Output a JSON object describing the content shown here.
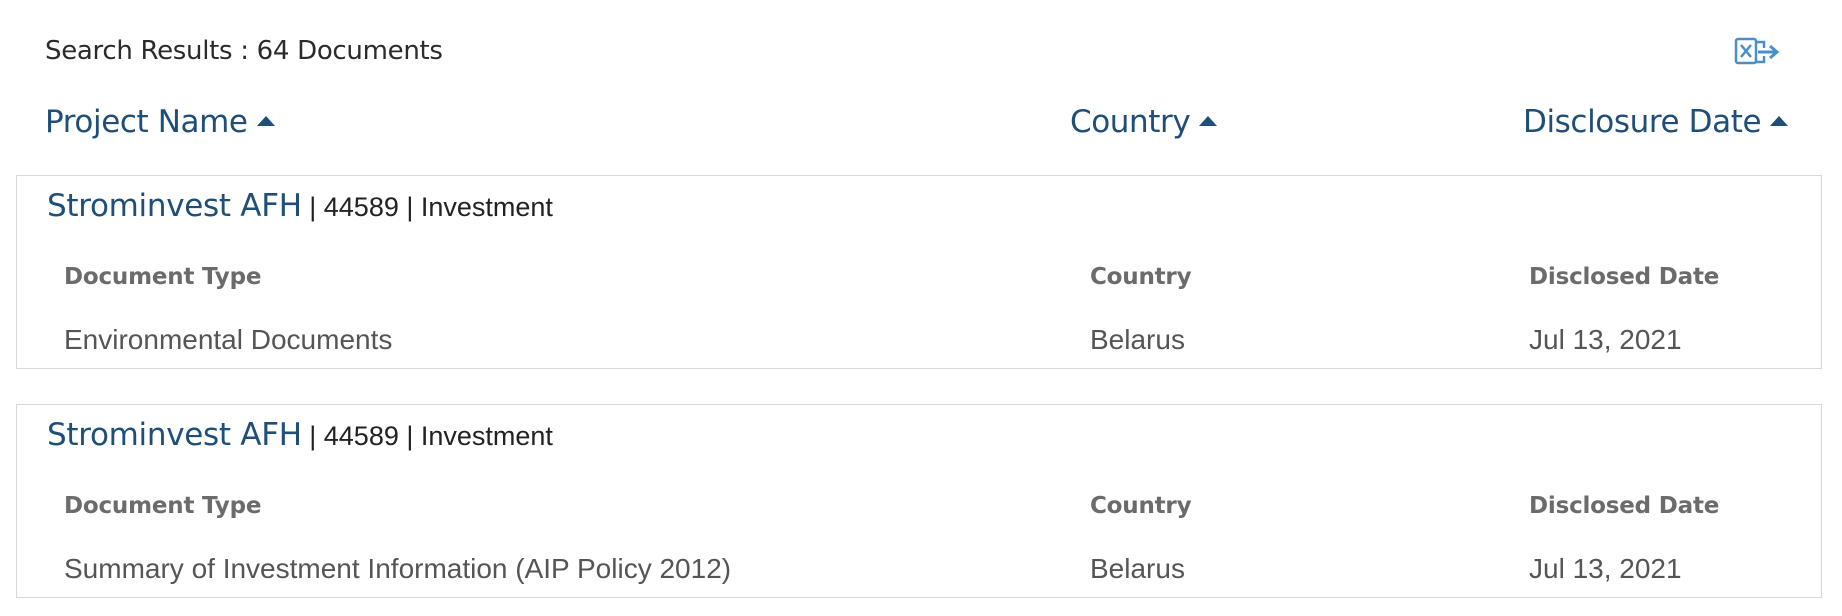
{
  "results": {
    "summary": "Search Results : 64 Documents",
    "export_icon": "excel-export-icon"
  },
  "columns": {
    "project_name": "Project Name",
    "country": "Country",
    "disclosure_date": "Disclosure Date",
    "sort_icon": "sort-ascending-icon"
  },
  "documents": [
    {
      "project_name": "Strominvest AFH",
      "meta": " | 44589 | Investment",
      "labels": {
        "document_type": "Document Type",
        "country": "Country",
        "disclosed_date": "Disclosed Date"
      },
      "document_type": "Environmental Documents",
      "country": "Belarus",
      "disclosed_date": "Jul 13, 2021"
    },
    {
      "project_name": "Strominvest AFH",
      "meta": " | 44589 | Investment",
      "labels": {
        "document_type": "Document Type",
        "country": "Country",
        "disclosed_date": "Disclosed Date"
      },
      "document_type": "Summary of Investment Information (AIP Policy 2012)",
      "country": "Belarus",
      "disclosed_date": "Jul 13, 2021"
    }
  ],
  "colors": {
    "link": "#1f4e79",
    "label": "#6b6b6b",
    "value": "#555555",
    "border": "#d9d9d9",
    "export_icon": "#4a90c8"
  }
}
